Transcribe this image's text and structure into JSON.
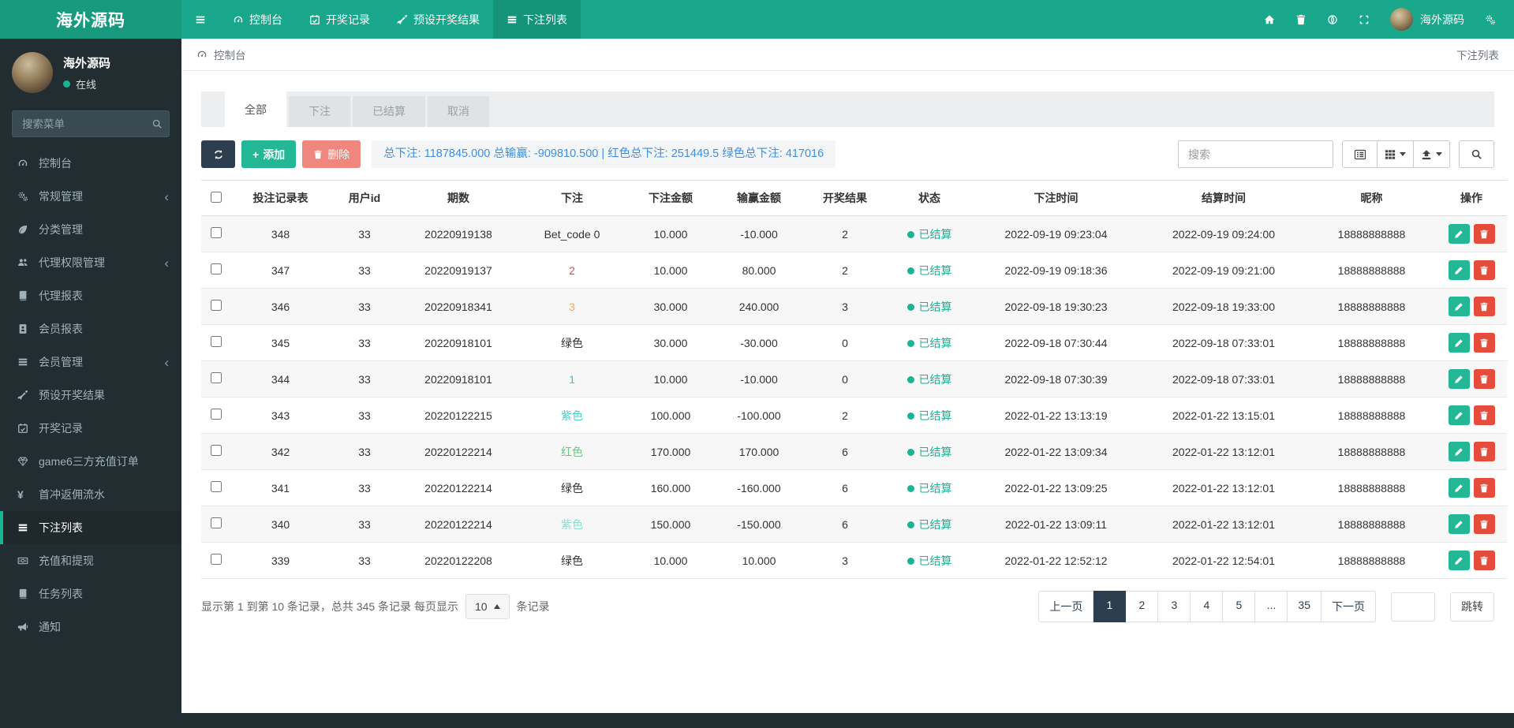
{
  "colors": {
    "navbar": "#19a88b",
    "navbar_active": "#16947a",
    "sidebar": "#222d32",
    "accent": "#1ab394",
    "navy": "#2c3e50",
    "add_green": "#23b795",
    "delete_soft_red": "#f0877e",
    "delete_red": "#e64c3c",
    "summary_blue": "#4090e2"
  },
  "navbar": {
    "logo": "海外源码",
    "menu": [
      {
        "label": "控制台",
        "icon": "gauge-icon",
        "active": false
      },
      {
        "label": "开奖记录",
        "icon": "calendar-icon",
        "active": false
      },
      {
        "label": "预设开奖结果",
        "icon": "pen-icon",
        "active": false
      },
      {
        "label": "下注列表",
        "icon": "list-icon",
        "active": true
      }
    ],
    "user_name": "海外源码"
  },
  "sidebar": {
    "profile": {
      "name": "海外源码",
      "status": "在线"
    },
    "search_placeholder": "搜索菜单",
    "items": [
      {
        "label": "控制台",
        "icon": "gauge-icon",
        "arrow": false,
        "active": false
      },
      {
        "label": "常规管理",
        "icon": "gears-icon",
        "arrow": true,
        "active": false
      },
      {
        "label": "分类管理",
        "icon": "leaf-icon",
        "arrow": false,
        "active": false
      },
      {
        "label": "代理权限管理",
        "icon": "users-icon",
        "arrow": true,
        "active": false
      },
      {
        "label": "代理报表",
        "icon": "book-icon",
        "arrow": false,
        "active": false
      },
      {
        "label": "会员报表",
        "icon": "idcard-icon",
        "arrow": false,
        "active": false
      },
      {
        "label": "会员管理",
        "icon": "list-icon",
        "arrow": true,
        "active": false
      },
      {
        "label": "预设开奖结果",
        "icon": "pen-icon",
        "arrow": false,
        "active": false
      },
      {
        "label": "开奖记录",
        "icon": "calendar-icon",
        "arrow": false,
        "active": false
      },
      {
        "label": "game6三方充值订单",
        "icon": "gem-icon",
        "arrow": false,
        "active": false
      },
      {
        "label": "首冲返佣流水",
        "icon": "yen-icon",
        "arrow": false,
        "active": false
      },
      {
        "label": "下注列表",
        "icon": "list-icon",
        "arrow": false,
        "active": true
      },
      {
        "label": "充值和提现",
        "icon": "money-icon",
        "arrow": false,
        "active": false
      },
      {
        "label": "任务列表",
        "icon": "book-icon",
        "arrow": false,
        "active": false
      },
      {
        "label": "通知",
        "icon": "bullhorn-icon",
        "arrow": false,
        "active": false
      }
    ]
  },
  "breadcrumb": {
    "title": "控制台",
    "right": "下注列表"
  },
  "tabs": [
    {
      "label": "全部",
      "active": true
    },
    {
      "label": "下注",
      "active": false
    },
    {
      "label": "已结算",
      "active": false
    },
    {
      "label": "取消",
      "active": false
    }
  ],
  "toolbar": {
    "add_label": "添加",
    "delete_label": "删除",
    "summary": "总下注: 1187845.000 总输赢: -909810.500 | 红色总下注: 251449.5 绿色总下注: 417016",
    "search_placeholder": "搜索"
  },
  "table": {
    "columns": [
      "投注记录表",
      "用户id",
      "期数",
      "下注",
      "下注金额",
      "输赢金额",
      "开奖结果",
      "状态",
      "下注时间",
      "结算时间",
      "昵称",
      "操作"
    ],
    "status_label": "已结算",
    "rows": [
      {
        "id": "348",
        "uid": "33",
        "period": "20220919138",
        "bet": "Bet_code 0",
        "bet_color": "",
        "amount": "10.000",
        "winlose": "-10.000",
        "result": "2",
        "bet_time": "2022-09-19 09:23:04",
        "settle_time": "2022-09-19 09:24:00",
        "nick": "18888888888"
      },
      {
        "id": "347",
        "uid": "33",
        "period": "20220919137",
        "bet": "2",
        "bet_color": "#c9504e",
        "amount": "10.000",
        "winlose": "80.000",
        "result": "2",
        "bet_time": "2022-09-19 09:18:36",
        "settle_time": "2022-09-19 09:21:00",
        "nick": "18888888888"
      },
      {
        "id": "346",
        "uid": "33",
        "period": "20220918341",
        "bet": "3",
        "bet_color": "#f0ad4e",
        "amount": "30.000",
        "winlose": "240.000",
        "result": "3",
        "bet_time": "2022-09-18 19:30:23",
        "settle_time": "2022-09-18 19:33:00",
        "nick": "18888888888"
      },
      {
        "id": "345",
        "uid": "33",
        "period": "20220918101",
        "bet": "绿色",
        "bet_color": "",
        "amount": "30.000",
        "winlose": "-30.000",
        "result": "0",
        "bet_time": "2022-09-18 07:30:44",
        "settle_time": "2022-09-18 07:33:01",
        "nick": "18888888888"
      },
      {
        "id": "344",
        "uid": "33",
        "period": "20220918101",
        "bet": "1",
        "bet_color": "#46b8da",
        "amount": "10.000",
        "winlose": "-10.000",
        "result": "0",
        "bet_time": "2022-09-18 07:30:39",
        "settle_time": "2022-09-18 07:33:01",
        "nick": "18888888888"
      },
      {
        "id": "343",
        "uid": "33",
        "period": "20220122215",
        "bet": "紫色",
        "bet_color": "#4ecdc4",
        "amount": "100.000",
        "winlose": "-100.000",
        "result": "2",
        "bet_time": "2022-01-22 13:13:19",
        "settle_time": "2022-01-22 13:15:01",
        "nick": "18888888888"
      },
      {
        "id": "342",
        "uid": "33",
        "period": "20220122214",
        "bet": "红色",
        "bet_color": "#71c285",
        "amount": "170.000",
        "winlose": "170.000",
        "result": "6",
        "bet_time": "2022-01-22 13:09:34",
        "settle_time": "2022-01-22 13:12:01",
        "nick": "18888888888"
      },
      {
        "id": "341",
        "uid": "33",
        "period": "20220122214",
        "bet": "绿色",
        "bet_color": "",
        "amount": "160.000",
        "winlose": "-160.000",
        "result": "6",
        "bet_time": "2022-01-22 13:09:25",
        "settle_time": "2022-01-22 13:12:01",
        "nick": "18888888888"
      },
      {
        "id": "340",
        "uid": "33",
        "period": "20220122214",
        "bet": "紫色",
        "bet_color": "#8addcf",
        "amount": "150.000",
        "winlose": "-150.000",
        "result": "6",
        "bet_time": "2022-01-22 13:09:11",
        "settle_time": "2022-01-22 13:12:01",
        "nick": "18888888888"
      },
      {
        "id": "339",
        "uid": "33",
        "period": "20220122208",
        "bet": "绿色",
        "bet_color": "",
        "amount": "10.000",
        "winlose": "10.000",
        "result": "3",
        "bet_time": "2022-01-22 12:52:12",
        "settle_time": "2022-01-22 12:54:01",
        "nick": "18888888888"
      }
    ]
  },
  "pagination": {
    "info_prefix": "显示第 1 到第 10 条记录，总共 345 条记录 每页显示",
    "per_page": "10",
    "info_suffix": "条记录",
    "pages": [
      "上一页",
      "1",
      "2",
      "3",
      "4",
      "5",
      "...",
      "35",
      "下一页"
    ],
    "active_page": "1",
    "jump_label": "跳转"
  }
}
